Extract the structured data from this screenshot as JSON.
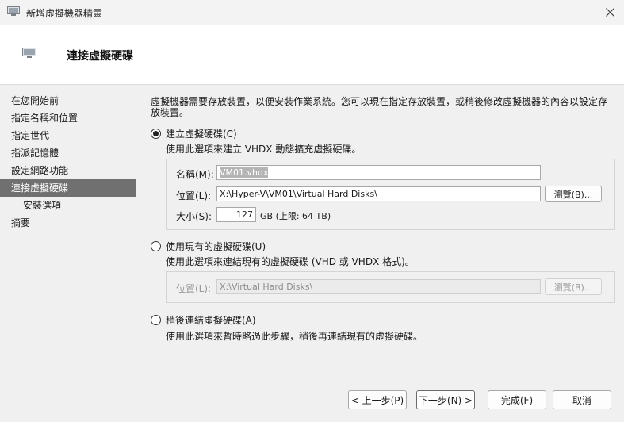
{
  "window": {
    "title": "新增虛擬機器精靈",
    "heading": "連接虛擬硬碟"
  },
  "sidebar": {
    "items": [
      {
        "label": "在您開始前"
      },
      {
        "label": "指定名稱和位置"
      },
      {
        "label": "指定世代"
      },
      {
        "label": "指派記憶體"
      },
      {
        "label": "設定網路功能"
      },
      {
        "label": "連接虛擬硬碟"
      },
      {
        "label": "安裝選項"
      },
      {
        "label": "摘要"
      }
    ]
  },
  "content": {
    "intro": "虛擬機器需要存放裝置，以便安裝作業系統。您可以現在指定存放裝置，或稍後修改虛擬機器的內容以設定存放裝置。",
    "create": {
      "label": "建立虛擬硬碟(C)",
      "description": "使用此選項來建立 VHDX 動態擴充虛擬硬碟。",
      "name_label": "名稱(M):",
      "name_value": "VM01.vhdx",
      "location_label": "位置(L):",
      "location_value": "X:\\Hyper-V\\VM01\\Virtual Hard Disks\\",
      "browse_label": "瀏覽(B)...",
      "size_label": "大小(S):",
      "size_value": "127",
      "size_unit": "GB (上限: 64 TB)"
    },
    "existing": {
      "label": "使用現有的虛擬硬碟(U)",
      "description": "使用此選項來連結現有的虛擬硬碟 (VHD 或 VHDX 格式)。",
      "location_label": "位置(L):",
      "location_value": "X:\\Virtual Hard Disks\\",
      "browse_label": "瀏覽(B)..."
    },
    "later": {
      "label": "稍後連結虛擬硬碟(A)",
      "description": "使用此選項來暫時略過此步驟，稍後再連結現有的虛擬硬碟。"
    }
  },
  "footer": {
    "back": "< 上一步(P)",
    "next": "下一步(N) >",
    "finish": "完成(F)",
    "cancel": "取消"
  }
}
